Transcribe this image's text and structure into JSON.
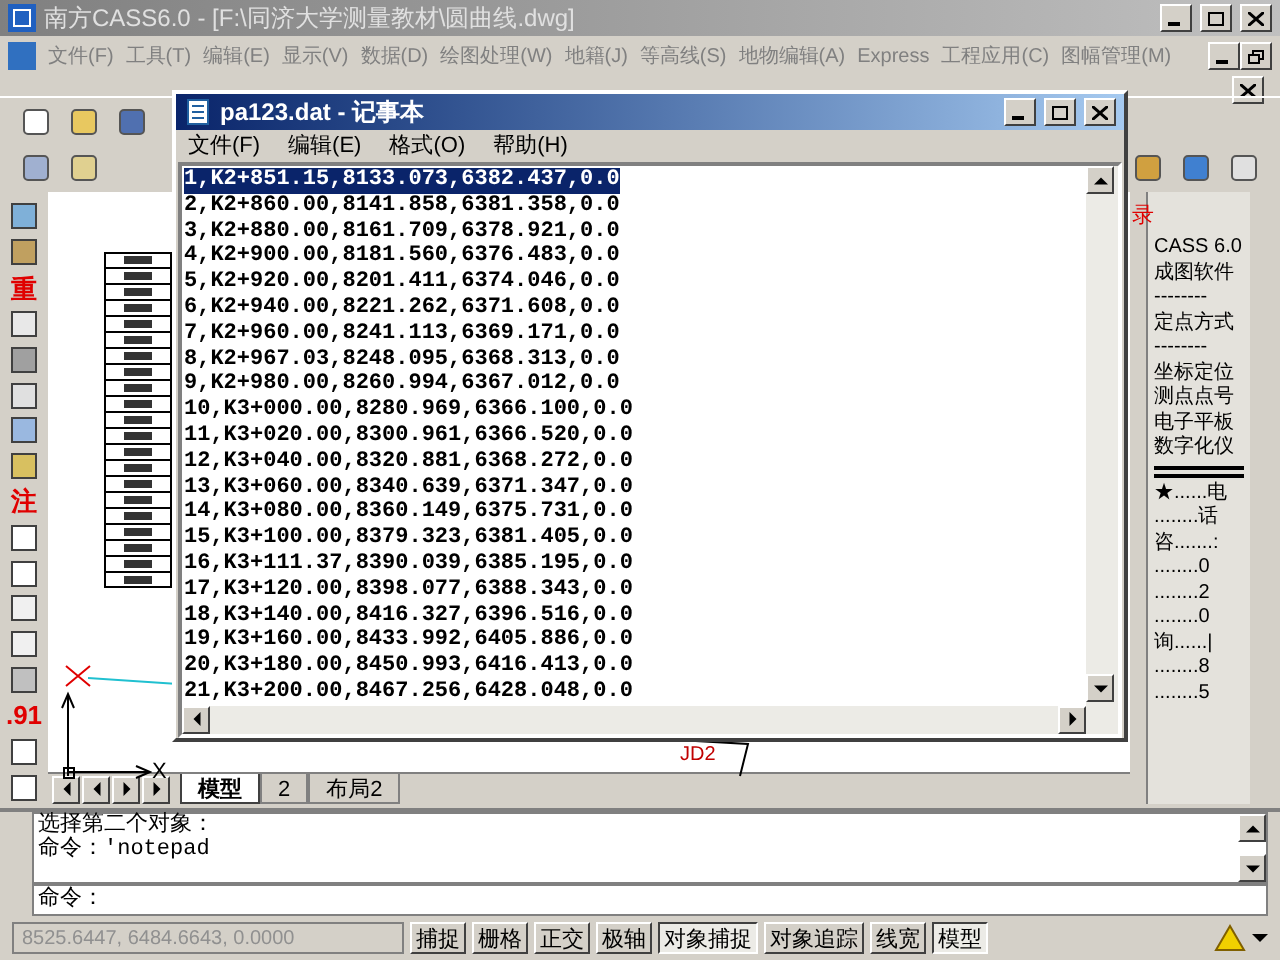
{
  "app_title": "南方CASS6.0 - [F:\\同济大学测量教材\\圆曲线.dwg]",
  "menu": [
    "文件(F)",
    "工具(T)",
    "编辑(E)",
    "显示(V)",
    "数据(D)",
    "绘图处理(W)",
    "地籍(J)",
    "等高线(S)",
    "地物编辑(A)",
    "Express",
    "工程应用(C)",
    "图幅管理(M)"
  ],
  "left_toolbar_glyphs": [
    "重",
    "注",
    ".91"
  ],
  "drawing": {
    "point_label": "JD2",
    "axis_label": "X"
  },
  "right_panel": {
    "side_mark": "录",
    "items": [
      {
        "kind": "text",
        "text": "CASS 6.0"
      },
      {
        "kind": "text",
        "text": "成图软件"
      },
      {
        "kind": "text",
        "text": "--------"
      },
      {
        "kind": "text",
        "text": "定点方式"
      },
      {
        "kind": "text",
        "text": "--------"
      },
      {
        "kind": "text",
        "text": "坐标定位"
      },
      {
        "kind": "text",
        "text": "测点点号"
      },
      {
        "kind": "text",
        "text": "电子平板"
      },
      {
        "kind": "text",
        "text": "数字化仪"
      },
      {
        "kind": "rule"
      },
      {
        "kind": "text",
        "text": "★......电"
      },
      {
        "kind": "text",
        "text": "........话"
      },
      {
        "kind": "text",
        "text": "咨.......:"
      },
      {
        "kind": "text",
        "text": "........0"
      },
      {
        "kind": "text",
        "text": "........2"
      },
      {
        "kind": "text",
        "text": "........0"
      },
      {
        "kind": "text",
        "text": "询......|"
      },
      {
        "kind": "text",
        "text": "........8"
      },
      {
        "kind": "text",
        "text": "........5"
      }
    ]
  },
  "notepad": {
    "title": "pa123.dat - 记事本",
    "menu": [
      "文件(F)",
      "编辑(E)",
      "格式(O)",
      "帮助(H)"
    ],
    "lines": [
      {
        "text": "1,K2+851.15,8133.073,6382.437,0.0",
        "selected": true
      },
      {
        "text": "2,K2+860.00,8141.858,6381.358,0.0",
        "selected": false
      },
      {
        "text": "3,K2+880.00,8161.709,6378.921,0.0",
        "selected": false
      },
      {
        "text": "4,K2+900.00,8181.560,6376.483,0.0",
        "selected": false
      },
      {
        "text": "5,K2+920.00,8201.411,6374.046,0.0",
        "selected": false
      },
      {
        "text": "6,K2+940.00,8221.262,6371.608,0.0",
        "selected": false
      },
      {
        "text": "7,K2+960.00,8241.113,6369.171,0.0",
        "selected": false
      },
      {
        "text": "8,K2+967.03,8248.095,6368.313,0.0",
        "selected": false
      },
      {
        "text": "9,K2+980.00,8260.994,6367.012,0.0",
        "selected": false
      },
      {
        "text": "10,K3+000.00,8280.969,6366.100,0.0",
        "selected": false
      },
      {
        "text": "11,K3+020.00,8300.961,6366.520,0.0",
        "selected": false
      },
      {
        "text": "12,K3+040.00,8320.881,6368.272,0.0",
        "selected": false
      },
      {
        "text": "13,K3+060.00,8340.639,6371.347,0.0",
        "selected": false
      },
      {
        "text": "14,K3+080.00,8360.149,6375.731,0.0",
        "selected": false
      },
      {
        "text": "15,K3+100.00,8379.323,6381.405,0.0",
        "selected": false
      },
      {
        "text": "16,K3+111.37,8390.039,6385.195,0.0",
        "selected": false
      },
      {
        "text": "17,K3+120.00,8398.077,6388.343,0.0",
        "selected": false
      },
      {
        "text": "18,K3+140.00,8416.327,6396.516,0.0",
        "selected": false
      },
      {
        "text": "19,K3+160.00,8433.992,6405.886,0.0",
        "selected": false
      },
      {
        "text": "20,K3+180.00,8450.993,6416.413,0.0",
        "selected": false
      },
      {
        "text": "21,K3+200.00,8467.256,6428.048,0.0",
        "selected": false
      }
    ]
  },
  "tabs": [
    {
      "label": "模型",
      "selected": true
    },
    {
      "label": "2",
      "selected": false
    },
    {
      "label": "布局2",
      "selected": false
    }
  ],
  "command": {
    "history": [
      "选择第二个对象：",
      "命令：'notepad"
    ],
    "prompt": "命令："
  },
  "status": {
    "coords": "8525.6447, 6484.6643, 0.0000",
    "toggles": [
      {
        "label": "捕捉",
        "on": false
      },
      {
        "label": "栅格",
        "on": false
      },
      {
        "label": "正交",
        "on": false
      },
      {
        "label": "极轴",
        "on": false
      },
      {
        "label": "对象捕捉",
        "on": true
      },
      {
        "label": "对象追踪",
        "on": false
      },
      {
        "label": "线宽",
        "on": false
      },
      {
        "label": "模型",
        "on": true
      }
    ]
  }
}
